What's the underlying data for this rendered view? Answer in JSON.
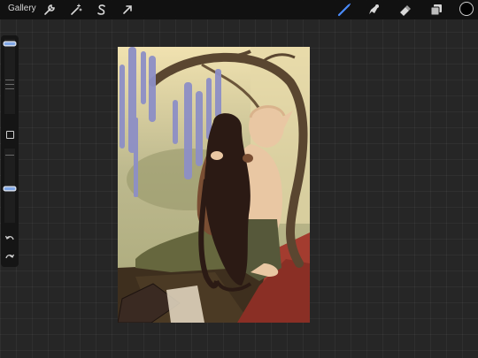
{
  "toolbar": {
    "gallery_label": "Gallery",
    "left_tools": [
      {
        "name": "actions",
        "icon": "wrench-icon"
      },
      {
        "name": "adjustments",
        "icon": "magic-wand-icon"
      },
      {
        "name": "selection",
        "icon": "selection-s-icon"
      },
      {
        "name": "transform",
        "icon": "arrow-cursor-icon"
      }
    ],
    "right_tools": [
      {
        "name": "brush",
        "icon": "brush-icon",
        "active": true
      },
      {
        "name": "smudge",
        "icon": "smudge-icon",
        "active": false
      },
      {
        "name": "eraser",
        "icon": "eraser-icon",
        "active": false
      },
      {
        "name": "layers",
        "icon": "layers-icon",
        "active": false
      }
    ],
    "current_color": "#000000",
    "active_tool_color": "#4a8cff"
  },
  "sidebar": {
    "brush_size_level": 0.95,
    "opacity_level": 0.55,
    "buttons": [
      "modify-square-icon",
      "undo-icon",
      "redo-icon"
    ]
  },
  "artwork": {
    "palette": {
      "sky": "#cfc79a",
      "wisteria": "#8d8fc6",
      "branch": "#5a4630",
      "skin_light": "#e9c7a3",
      "skin_dark": "#7a4e33",
      "hair": "#2b1a14",
      "skirt": "#66673e",
      "floor": "#3e2f1e",
      "cloth_red": "#a33c2f"
    }
  }
}
